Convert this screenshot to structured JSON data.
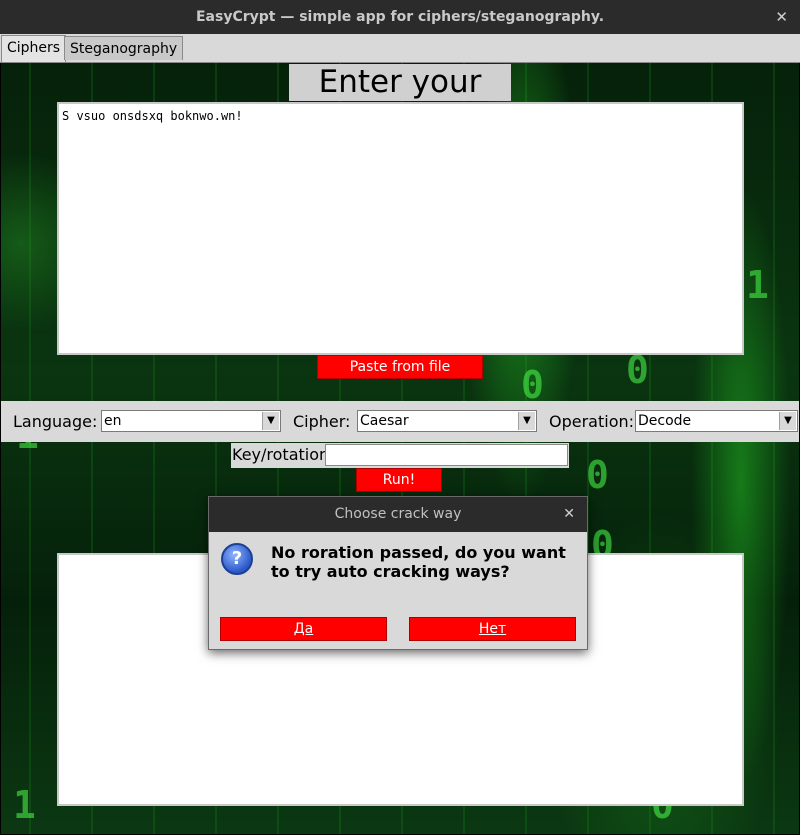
{
  "window": {
    "title": "EasyCrypt — simple app for ciphers/steganography.",
    "close_glyph": "✕"
  },
  "tabs": [
    {
      "label": "Ciphers",
      "active": true
    },
    {
      "label": "Steganography",
      "active": false
    }
  ],
  "main": {
    "heading": "Enter your text:",
    "input_text": "S vsuo onsdsxq boknwo.wn!",
    "paste_button": "Paste from file",
    "output_text": ""
  },
  "options": {
    "language_label": "Language:",
    "language_value": "en",
    "cipher_label": "Cipher:",
    "cipher_value": "Caesar",
    "operation_label": "Operation:",
    "operation_value": "Decode",
    "key_label": "Key/rotation:",
    "key_value": "",
    "run_button": "Run!"
  },
  "dialog": {
    "title": "Choose crack way",
    "close_glyph": "✕",
    "icon": "question-icon",
    "message": "No roration passed, do you want to try auto cracking ways?",
    "yes_label": "Да",
    "no_label": "Нет"
  },
  "colors": {
    "accent_button": "#ff0000",
    "titlebar": "#2b2b2b",
    "panel": "#d9d9d9"
  }
}
